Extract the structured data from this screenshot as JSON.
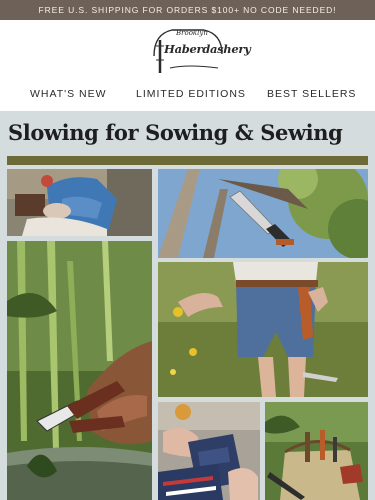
{
  "promo": {
    "text": "FREE U.S. SHIPPING FOR ORDERS $100+  NO CODE NEEDED!"
  },
  "logo": {
    "line1": "Brooklyn",
    "line2": "Haberdashery"
  },
  "nav": {
    "items": [
      {
        "label": "WHAT'S NEW"
      },
      {
        "label": "LIMITED EDITIONS"
      },
      {
        "label": "BEST SELLERS"
      }
    ]
  },
  "hero": {
    "headline": "Slowing for Sowing & Sewing"
  },
  "colors": {
    "promo_bg": "#6e6258",
    "hero_bg": "#d5dcde",
    "olive_band": "#6c6b38"
  },
  "photos": [
    {
      "icon": "person-sewing-photo"
    },
    {
      "icon": "pruning-saw-photo"
    },
    {
      "icon": "pruning-shears-photo"
    },
    {
      "icon": "gardener-holster-photo"
    },
    {
      "icon": "sewing-kit-photo"
    },
    {
      "icon": "tool-bag-photo"
    }
  ]
}
